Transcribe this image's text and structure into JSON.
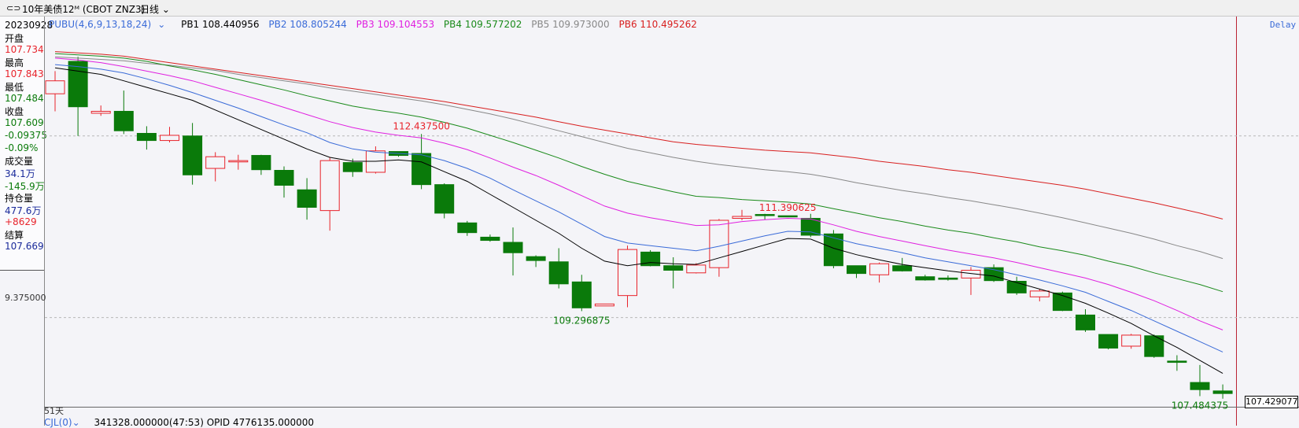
{
  "topbar": {
    "title": "10年美债12ᴹ (CBOT ZNZ3)",
    "period": "日线"
  },
  "left_panel": {
    "date": "20230928",
    "open_label": "开盘",
    "open_value": "107.734",
    "high_label": "最高",
    "high_value": "107.843",
    "low_label": "最低",
    "low_value": "107.484",
    "close_label": "收盘",
    "close_value": "107.609",
    "change_value": "-0.09375",
    "change_pct": "-0.09%",
    "volume_label": "成交量",
    "volume_value": "34.1万",
    "volume_change": "-145.9万",
    "oi_label": "持仓量",
    "oi_value": "477.6万",
    "oi_change": "+8629",
    "settle_label": "结算",
    "settle_value": "107.669"
  },
  "indicator": {
    "name": "PUBU(4,6,9,13,18,24)",
    "pb1": "PB1 108.440956",
    "pb2": "PB2 108.805244",
    "pb3": "PB3 109.104553",
    "pb4": "PB4 109.577202",
    "pb5": "PB5 109.973000",
    "pb6": "PB6 110.495262"
  },
  "delay_label": "Delay",
  "y_axis_label": "9.375000",
  "day_label": "51天",
  "current_price": "107.429077",
  "sub_indicator": {
    "tab": "CJL(0)",
    "values": "341328.000000(47:53)   OPID 4776135.000000"
  },
  "colors": {
    "up": "#e8232b",
    "down": "#0a7a0a",
    "pb1": "#000000",
    "pb2": "#3a6bd8",
    "pb3": "#e020e0",
    "pb4": "#1a8a1a",
    "pb5": "#888888",
    "pb6": "#d81f1f"
  },
  "chart_data": {
    "type": "candlestick",
    "candles": [
      [
        108.0,
        108.35,
        107.73,
        108.2
      ],
      [
        108.5,
        108.57,
        107.35,
        107.8
      ],
      [
        107.7,
        107.82,
        107.66,
        107.73
      ],
      [
        107.73,
        108.05,
        107.38,
        107.43
      ],
      [
        107.39,
        107.5,
        107.14,
        107.28
      ],
      [
        107.28,
        107.49,
        107.25,
        107.36
      ],
      [
        107.35,
        107.55,
        106.6,
        106.75
      ],
      [
        106.85,
        107.1,
        106.65,
        107.03
      ],
      [
        106.95,
        107.06,
        106.83,
        106.97
      ],
      [
        107.05,
        107.06,
        106.75,
        106.83
      ],
      [
        106.82,
        106.88,
        106.4,
        106.59
      ],
      [
        106.52,
        106.7,
        106.06,
        106.25
      ],
      [
        106.2,
        107.02,
        105.89,
        106.97
      ],
      [
        106.94,
        107.0,
        106.72,
        106.8
      ],
      [
        106.79,
        107.19,
        106.77,
        107.12
      ],
      [
        107.11,
        107.09,
        107.03,
        107.05
      ],
      [
        107.08,
        107.38,
        106.53,
        106.6
      ],
      [
        106.6,
        106.62,
        106.08,
        106.16
      ],
      [
        106.01,
        106.04,
        105.81,
        105.86
      ],
      [
        105.79,
        105.83,
        105.72,
        105.74
      ],
      [
        105.71,
        105.94,
        105.2,
        105.55
      ],
      [
        105.49,
        105.51,
        105.33,
        105.43
      ],
      [
        105.41,
        105.62,
        105.0,
        105.07
      ],
      [
        105.1,
        105.21,
        104.65,
        104.7
      ],
      [
        104.73,
        104.76,
        104.73,
        104.76
      ],
      [
        104.89,
        105.66,
        104.71,
        105.6
      ],
      [
        105.56,
        105.59,
        105.34,
        105.35
      ],
      [
        105.35,
        105.48,
        105.0,
        105.28
      ],
      [
        105.24,
        105.39,
        105.23,
        105.36
      ],
      [
        105.32,
        106.07,
        105.18,
        106.05
      ],
      [
        106.08,
        106.21,
        106.05,
        106.11
      ],
      [
        106.14,
        106.15,
        106.06,
        106.13
      ],
      [
        106.12,
        106.12,
        106.11,
        106.11
      ],
      [
        106.08,
        106.15,
        105.79,
        105.82
      ],
      [
        105.84,
        105.9,
        105.31,
        105.35
      ],
      [
        105.35,
        105.35,
        105.16,
        105.23
      ],
      [
        105.21,
        105.4,
        105.09,
        105.38
      ],
      [
        105.35,
        105.47,
        105.26,
        105.27
      ],
      [
        105.18,
        105.21,
        105.12,
        105.13
      ],
      [
        105.16,
        105.2,
        105.12,
        105.14
      ],
      [
        105.16,
        105.33,
        104.9,
        105.28
      ],
      [
        105.32,
        105.37,
        105.1,
        105.12
      ],
      [
        105.11,
        105.18,
        104.9,
        104.93
      ],
      [
        104.87,
        104.99,
        104.8,
        104.96
      ],
      [
        104.93,
        104.95,
        104.65,
        104.66
      ],
      [
        104.59,
        104.68,
        104.33,
        104.36
      ],
      [
        104.29,
        104.29,
        104.06,
        104.08
      ],
      [
        104.11,
        104.3,
        104.07,
        104.28
      ],
      [
        104.27,
        104.29,
        103.93,
        103.95
      ],
      [
        103.88,
        103.97,
        103.73,
        103.86
      ],
      [
        103.55,
        103.82,
        103.34,
        103.44
      ],
      [
        103.42,
        103.52,
        103.3,
        103.38
      ]
    ],
    "pb1": [
      108.4,
      108.35,
      108.3,
      108.2,
      108.1,
      108.0,
      107.9,
      107.75,
      107.6,
      107.45,
      107.3,
      107.15,
      107.02,
      106.96,
      106.96,
      106.98,
      106.95,
      106.8,
      106.65,
      106.45,
      106.25,
      106.05,
      105.85,
      105.62,
      105.42,
      105.35,
      105.4,
      105.38,
      105.37,
      105.47,
      105.57,
      105.67,
      105.77,
      105.76,
      105.62,
      105.52,
      105.44,
      105.37,
      105.32,
      105.27,
      105.23,
      105.19,
      105.09,
      104.99,
      104.89,
      104.77,
      104.62,
      104.46,
      104.27,
      104.09,
      103.89,
      103.69
    ],
    "pb2": [
      108.45,
      108.42,
      108.38,
      108.32,
      108.23,
      108.13,
      108.02,
      107.9,
      107.78,
      107.65,
      107.52,
      107.4,
      107.25,
      107.15,
      107.1,
      107.08,
      107.06,
      106.97,
      106.85,
      106.7,
      106.52,
      106.35,
      106.18,
      105.99,
      105.8,
      105.7,
      105.66,
      105.62,
      105.58,
      105.65,
      105.73,
      105.81,
      105.88,
      105.87,
      105.78,
      105.69,
      105.62,
      105.55,
      105.47,
      105.41,
      105.35,
      105.29,
      105.21,
      105.13,
      105.04,
      104.94,
      104.8,
      104.66,
      104.5,
      104.34,
      104.18,
      104.02
    ],
    "pb3": [
      108.55,
      108.52,
      108.48,
      108.42,
      108.35,
      108.28,
      108.2,
      108.1,
      108.0,
      107.9,
      107.79,
      107.68,
      107.57,
      107.48,
      107.41,
      107.36,
      107.32,
      107.24,
      107.14,
      107.01,
      106.87,
      106.74,
      106.59,
      106.43,
      106.27,
      106.16,
      106.09,
      106.03,
      105.97,
      105.98,
      106.03,
      106.06,
      106.08,
      106.07,
      105.98,
      105.88,
      105.8,
      105.73,
      105.66,
      105.59,
      105.53,
      105.47,
      105.4,
      105.32,
      105.24,
      105.16,
      105.06,
      104.94,
      104.81,
      104.66,
      104.5,
      104.36
    ],
    "pb4": [
      108.62,
      108.6,
      108.58,
      108.55,
      108.5,
      108.43,
      108.37,
      108.3,
      108.22,
      108.14,
      108.06,
      107.97,
      107.89,
      107.81,
      107.75,
      107.7,
      107.64,
      107.56,
      107.47,
      107.36,
      107.25,
      107.13,
      107.01,
      106.88,
      106.76,
      106.65,
      106.57,
      106.49,
      106.42,
      106.4,
      106.37,
      106.35,
      106.33,
      106.3,
      106.23,
      106.16,
      106.09,
      106.03,
      105.96,
      105.9,
      105.85,
      105.78,
      105.72,
      105.64,
      105.58,
      105.51,
      105.42,
      105.34,
      105.24,
      105.15,
      105.06,
      104.95
    ],
    "pb5": [
      108.57,
      108.55,
      108.53,
      108.51,
      108.47,
      108.44,
      108.4,
      108.36,
      108.3,
      108.25,
      108.2,
      108.15,
      108.09,
      108.04,
      107.99,
      107.94,
      107.89,
      107.83,
      107.76,
      107.69,
      107.61,
      107.52,
      107.43,
      107.34,
      107.25,
      107.16,
      107.09,
      107.02,
      106.96,
      106.91,
      106.87,
      106.83,
      106.8,
      106.76,
      106.7,
      106.63,
      106.57,
      106.51,
      106.46,
      106.4,
      106.35,
      106.29,
      106.23,
      106.16,
      106.09,
      106.01,
      105.93,
      105.85,
      105.76,
      105.66,
      105.57,
      105.46
    ],
    "pb6": [
      108.65,
      108.63,
      108.61,
      108.58,
      108.53,
      108.48,
      108.43,
      108.38,
      108.33,
      108.28,
      108.23,
      108.18,
      108.13,
      108.08,
      108.03,
      107.98,
      107.93,
      107.88,
      107.82,
      107.76,
      107.7,
      107.64,
      107.57,
      107.5,
      107.44,
      107.38,
      107.32,
      107.26,
      107.22,
      107.19,
      107.16,
      107.13,
      107.11,
      107.09,
      107.05,
      107.01,
      106.96,
      106.92,
      106.88,
      106.83,
      106.79,
      106.74,
      106.69,
      106.64,
      106.59,
      106.53,
      106.46,
      106.39,
      106.32,
      106.24,
      106.16,
      106.07
    ],
    "annotations": [
      {
        "text": "112.437500",
        "index": 16,
        "value": 107.38,
        "pos": "above",
        "color": "#e8232b"
      },
      {
        "text": "111.390625",
        "index": 32,
        "value": 106.12,
        "pos": "above",
        "color": "#e8232b"
      },
      {
        "text": "109.296875",
        "index": 23,
        "value": 104.65,
        "pos": "below",
        "color": "#0a7a0a"
      },
      {
        "text": "107.484375",
        "index": 50,
        "value": 103.34,
        "pos": "below",
        "color": "#0a7a0a"
      }
    ],
    "dashed_levels": [
      107.35,
      104.55
    ],
    "y_top": 108.9,
    "y_bottom": 103.2
  }
}
